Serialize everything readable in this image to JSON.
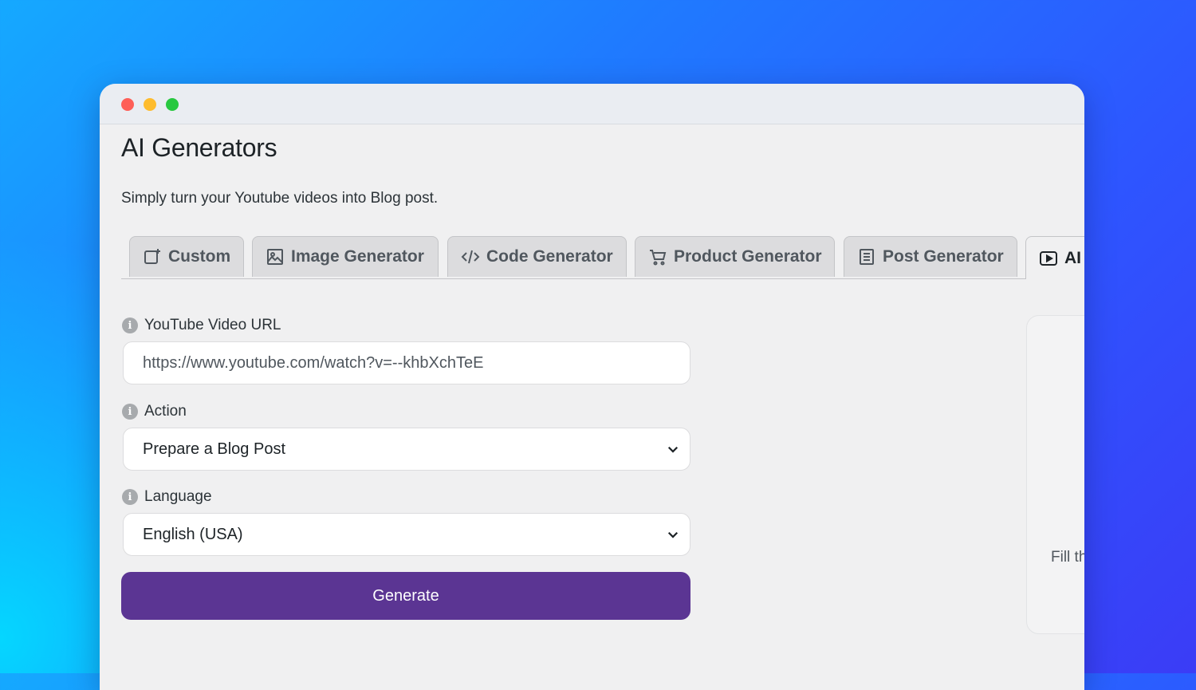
{
  "window": {
    "title": "AI Generators",
    "subtitle": "Simply turn your Youtube videos into Blog post."
  },
  "tabs": [
    {
      "label": "Custom",
      "icon": "custom-edit-icon",
      "active": false
    },
    {
      "label": "Image Generator",
      "icon": "image-icon",
      "active": false
    },
    {
      "label": "Code Generator",
      "icon": "code-icon",
      "active": false
    },
    {
      "label": "Product Generator",
      "icon": "cart-icon",
      "active": false
    },
    {
      "label": "Post Generator",
      "icon": "document-icon",
      "active": false
    },
    {
      "label": "AI",
      "icon": "youtube-play-icon",
      "active": true
    }
  ],
  "form": {
    "url_label": "YouTube Video URL",
    "url_value": "https://www.youtube.com/watch?v=--khbXchTeE",
    "action_label": "Action",
    "action_value": "Prepare a Blog Post",
    "language_label": "Language",
    "language_value": "English (USA)",
    "generate_label": "Generate"
  },
  "side_panel": {
    "text": "Fill th"
  },
  "colors": {
    "accent": "#5b3593",
    "background_gradient_start": "#00e6ff",
    "background_gradient_end": "#3b3cf6"
  }
}
